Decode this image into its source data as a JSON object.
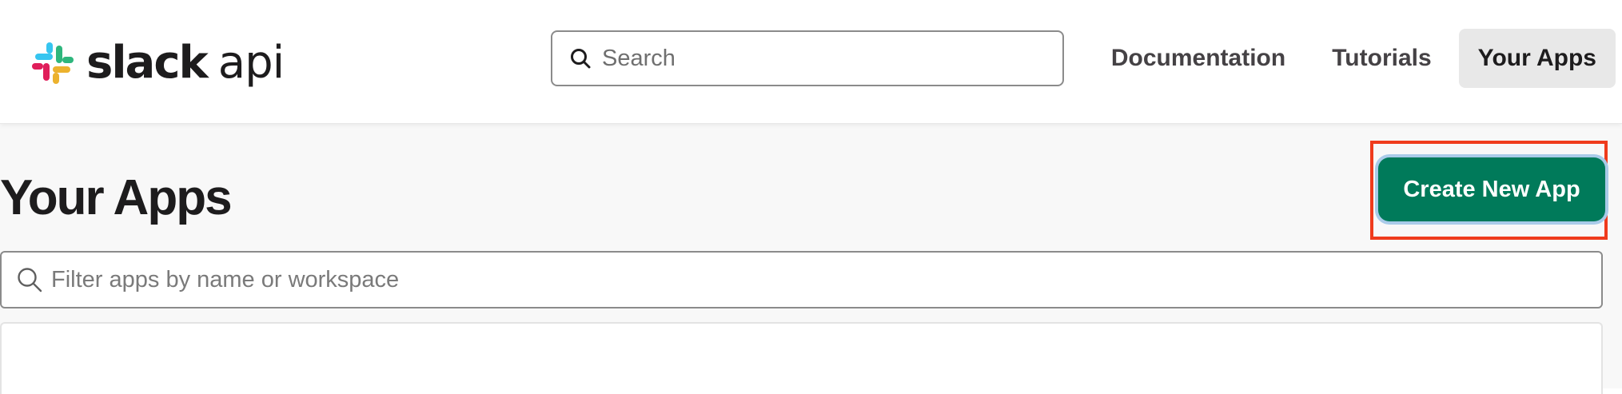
{
  "header": {
    "logo": {
      "wordmark": "slack",
      "suffix": "api",
      "icon": "slack-logo-icon",
      "colors": [
        "#36c5f0",
        "#2eb67d",
        "#ecb22e",
        "#e01e5a"
      ]
    },
    "search": {
      "placeholder": "Search",
      "value": "",
      "icon": "search-icon"
    },
    "nav": {
      "documentation": "Documentation",
      "tutorials": "Tutorials",
      "your_apps": "Your Apps",
      "active": "Your Apps"
    }
  },
  "main": {
    "title": "Your Apps",
    "create_button": {
      "label": "Create New App",
      "color": "#007a5a",
      "highlighted": true,
      "highlight_color": "#ef3b1c"
    },
    "filter": {
      "placeholder": "Filter apps by name or workspace",
      "value": "",
      "icon": "search-icon"
    }
  },
  "colors": {
    "text": "#1d1c1d",
    "nav_text": "#454245",
    "active_nav_bg": "#e8e8e8",
    "page_bg": "#f8f8f8"
  }
}
